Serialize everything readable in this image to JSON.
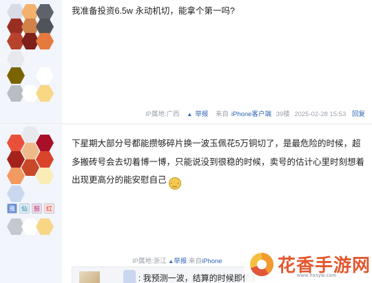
{
  "post1": {
    "text": "我准备投资6.5w 永动机切，能拿个第一吗?",
    "meta": {
      "ip_location": "IP属地:广西",
      "report": "举报",
      "client_prefix": "来自",
      "client": "iPhone客户端",
      "floor": "39楼",
      "timestamp": "2025-02-28 15:53",
      "reply": "回复"
    }
  },
  "post2": {
    "text": "下星期大部分号都能攒够碎片换一波玉佩花5万铜切了，是最危险的时候，超多搬砖号会去切着博一博，只能说没到很稳的时候，卖号的估计心里时刻想着出现更高分的能安慰自己",
    "badges": [
      "雅",
      "仙",
      "鲸",
      "红"
    ],
    "meta": {
      "ip_location": "IP属地:浙江",
      "report": "举报",
      "client_prefix": "来自",
      "client": "iPhone"
    },
    "reply_preview": ": 我预测一波，结算的时候即使3"
  },
  "watermark": {
    "title": "花香手游网",
    "url": "www.hxsyw.com"
  },
  "colors": {
    "link": "#2d64b3",
    "meta_gray": "#9aa0aa",
    "sidebar_bg": "#f2f5fb",
    "watermark_red": "#e4572e"
  }
}
